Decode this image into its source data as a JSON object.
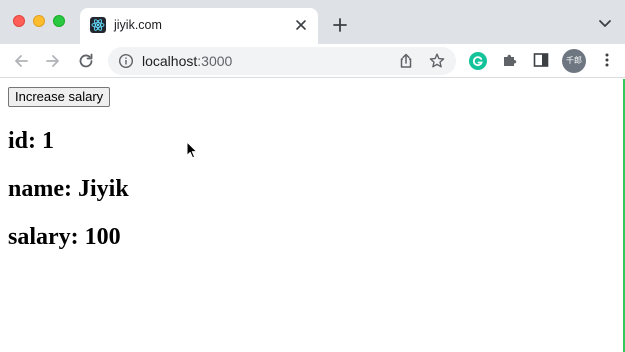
{
  "browser": {
    "tab": {
      "title": "jiyik.com"
    },
    "address": {
      "host": "localhost",
      "port": ":3000"
    },
    "profile_initials": "千郎",
    "icons": {
      "favicon": "react-icon",
      "tab_close": "close-icon",
      "new_tab": "plus-icon",
      "tab_menu": "chevron-down-icon",
      "back": "back-arrow-icon",
      "forward": "forward-arrow-icon",
      "reload": "reload-icon",
      "site_info": "info-icon",
      "share": "share-icon",
      "bookmark": "star-icon",
      "grammarly": "grammarly-icon",
      "extensions": "puzzle-icon",
      "side_panel": "side-panel-icon",
      "menu": "kebab-menu-icon"
    }
  },
  "page": {
    "button_label": "Increase salary",
    "fields": {
      "id": "id: 1",
      "name": "name: Jiyik",
      "salary": "salary: 100"
    }
  },
  "colors": {
    "titlebar": "#dee1e6",
    "omnibox": "#f1f3f4",
    "grammarly": "#15c39a",
    "edge_accent": "#34c759"
  }
}
